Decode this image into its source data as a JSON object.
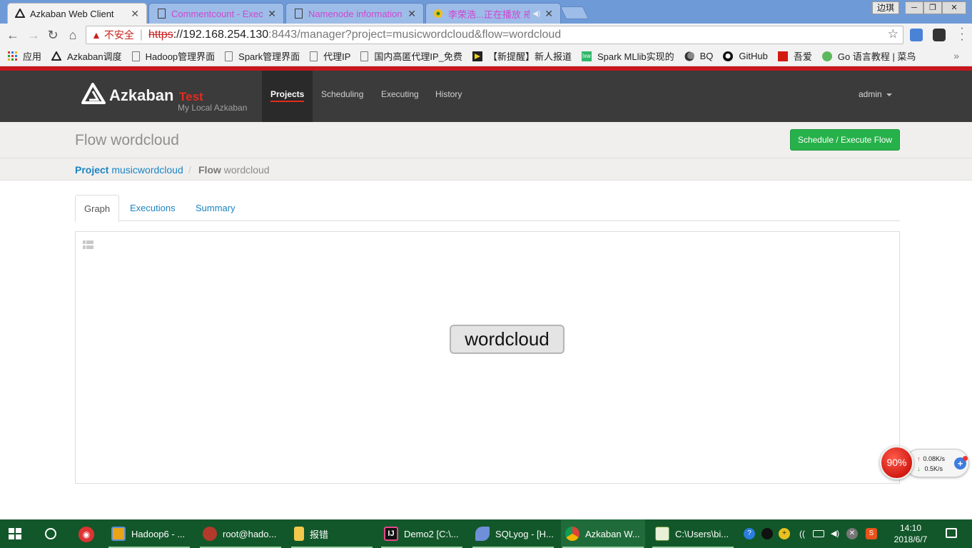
{
  "browser": {
    "tabs": [
      {
        "title": "Azkaban Web Client",
        "favicon": "azkaban-icon",
        "active": true
      },
      {
        "title": "Commentcount - Execu",
        "favicon": "page-icon",
        "active": false
      },
      {
        "title": "Namenode information",
        "favicon": "page-icon",
        "active": false
      },
      {
        "title": "李荣浩...正在播放 戒烟",
        "favicon": "music-icon",
        "active": false
      }
    ],
    "window_user": "边琪",
    "address": {
      "warning_icon": "warning-icon",
      "insecure_label": "不安全",
      "scheme": "https",
      "host": "://192.168.254.130",
      "rest": ":8443/manager?project=musicwordcloud&flow=wordcloud"
    },
    "bookmarks": [
      {
        "label": "应用",
        "icon": "apps-grid-icon"
      },
      {
        "label": "Azkaban调度",
        "icon": "azkaban-icon"
      },
      {
        "label": "Hadoop管理界面",
        "icon": "page-icon"
      },
      {
        "label": "Spark管理界面",
        "icon": "page-icon"
      },
      {
        "label": "代理IP",
        "icon": "page-icon"
      },
      {
        "label": "国内高匿代理IP_免费",
        "icon": "page-icon"
      },
      {
        "label": "【新提醒】新人报道",
        "icon": "flag-icon"
      },
      {
        "label": "Spark MLlib实现的",
        "icon": "lxw-icon"
      },
      {
        "label": "BQ",
        "icon": "moon-icon"
      },
      {
        "label": "GitHub",
        "icon": "github-icon"
      },
      {
        "label": "吾爱",
        "icon": "wuai-icon"
      },
      {
        "label": "Go 语言教程 | 菜鸟",
        "icon": "runoob-icon"
      }
    ]
  },
  "azkaban": {
    "brand": "Azkaban",
    "env": "Test",
    "subtitle": "My Local Azkaban",
    "nav": [
      "Projects",
      "Scheduling",
      "Executing",
      "History"
    ],
    "active_nav": "Projects",
    "user": "admin",
    "page_title": "Flow wordcloud",
    "execute_button": "Schedule / Execute Flow",
    "breadcrumb": {
      "project_label": "Project",
      "project_name": "musicwordcloud",
      "separator": "/",
      "flow_label": "Flow",
      "flow_name": "wordcloud"
    },
    "tabs": [
      "Graph",
      "Executions",
      "Summary"
    ],
    "active_tab": "Graph",
    "graph": {
      "nodes": [
        "wordcloud"
      ]
    }
  },
  "speed_widget": {
    "cpu_percent": "90%",
    "upload": "0.08K/s",
    "download": "0.5K/s"
  },
  "taskbar": {
    "apps": [
      {
        "label": "Hadoop6 - ...",
        "icon": "vmware-icon"
      },
      {
        "label": "root@hado...",
        "icon": "xshell-icon"
      },
      {
        "label": "报错",
        "icon": "folder-icon"
      },
      {
        "label": "Demo2 [C:\\...",
        "icon": "intellij-icon"
      },
      {
        "label": "SQLyog - [H...",
        "icon": "sqlyog-icon"
      },
      {
        "label": "Azkaban W...",
        "icon": "chrome-icon"
      },
      {
        "label": "C:\\Users\\bi...",
        "icon": "notepad-icon"
      }
    ],
    "time": "14:10",
    "date": "2018/6/7"
  },
  "colors": {
    "nav_bg": "#3b3b3b",
    "accent_red": "#e52a1e",
    "link_blue": "#1b84c4",
    "execute_green": "#27b14a",
    "taskbar_green": "#12572a"
  }
}
